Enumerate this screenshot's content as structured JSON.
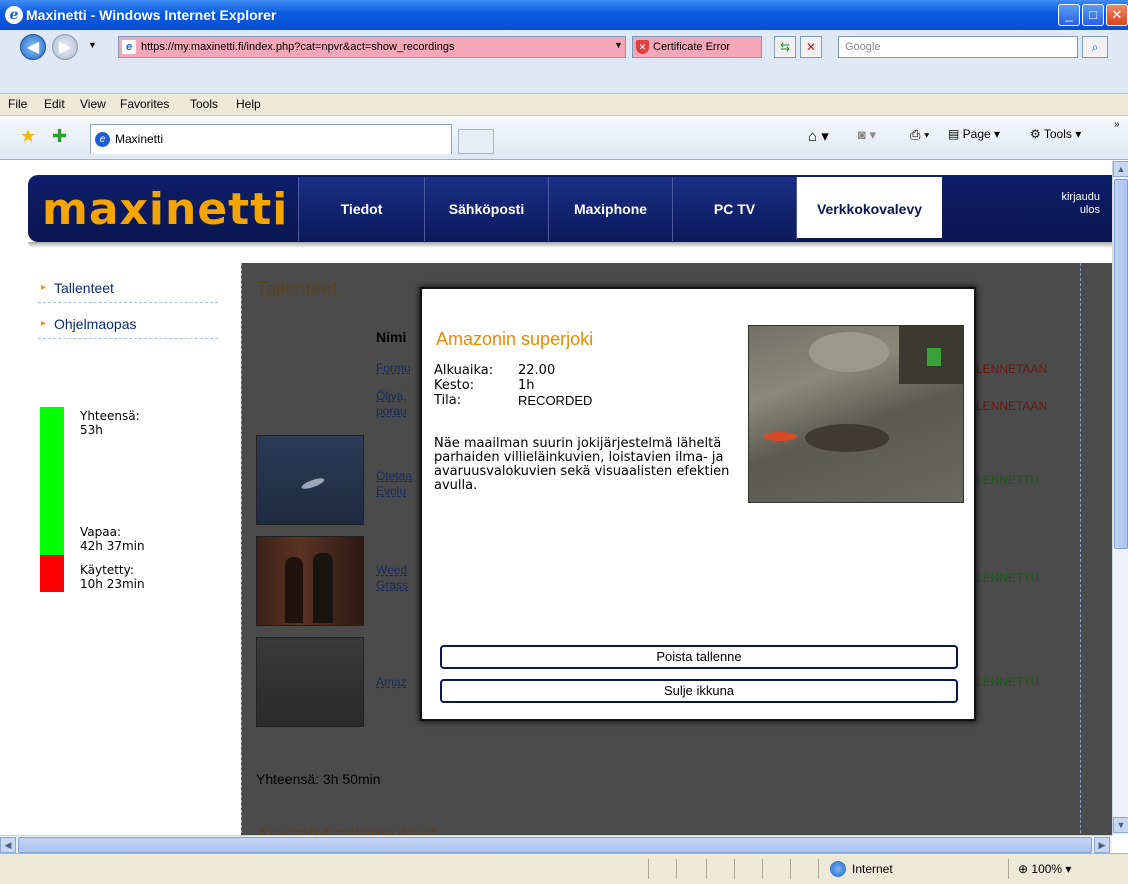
{
  "window": {
    "title": "Maxinetti - Windows Internet Explorer"
  },
  "addressbar": {
    "url": "https://my.maxinetti.fi/index.php?cat=npvr&act=show_recordings",
    "cert_label": "Certificate Error",
    "search_placeholder": "Google"
  },
  "menu": [
    "File",
    "Edit",
    "View",
    "Favorites",
    "Tools",
    "Help"
  ],
  "tabs": {
    "active_label": "Maxinetti"
  },
  "toolbar": {
    "page_label": "Page",
    "tools_label": "Tools"
  },
  "site": {
    "logo": "maxinetti",
    "nav": [
      "Tiedot",
      "Sähköposti",
      "Maxiphone",
      "PC TV",
      "Verkkokovalevy"
    ],
    "active_nav": "Verkkokovalevy",
    "logout_line1": "kirjaudu",
    "logout_line2": "ulos"
  },
  "sidebar": {
    "items": [
      "Tallenteet",
      "Ohjelmaopas"
    ],
    "storage": {
      "total_label": "Yhteensä:",
      "total_value": "53h",
      "free_label": "Vapaa:",
      "free_value": "42h 37min",
      "used_label": "Käytetty:",
      "used_value": "10h 23min",
      "free_fraction": 0.8,
      "free_color": "#00ff00",
      "used_color": "#ff0000"
    }
  },
  "recordings": {
    "title": "Tallenteet",
    "name_header": "Nimi",
    "rows": [
      {
        "name1": "Formu",
        "name2": "",
        "status": "LENNETAAN"
      },
      {
        "name1": "Öljyä,",
        "name2": "porau",
        "status": "LENNETAAN"
      },
      {
        "name1": "Otetaa",
        "name2": "Evolu",
        "status": "LENNETTU"
      },
      {
        "name1": "Weed",
        "name2": "Grass",
        "status": "LENNETTU"
      },
      {
        "name1": "Amaz",
        "name2": "",
        "status": "LENNETTU"
      }
    ],
    "total": "Yhteensä: 3h 50min",
    "next_section": "Ajastetut tallennukset"
  },
  "modal": {
    "title": "Amazonin superjoki",
    "start_label": "Alkuaika:",
    "start_value": "22.00",
    "duration_label": "Kesto:",
    "duration_value": "1h",
    "state_label": "Tila:",
    "state_value": "RECORDED",
    "description": "Näe maailman suurin jokijärjestelmä läheltä parhaiden villieläinkuvien, loistavien ilma- ja avaruusvalokuvien sekä visuaalisten efektien avulla.",
    "delete_button": "Poista tallenne",
    "close_button": "Sulje ikkuna"
  },
  "statusbar": {
    "zone": "Internet",
    "zoom": "100%"
  }
}
